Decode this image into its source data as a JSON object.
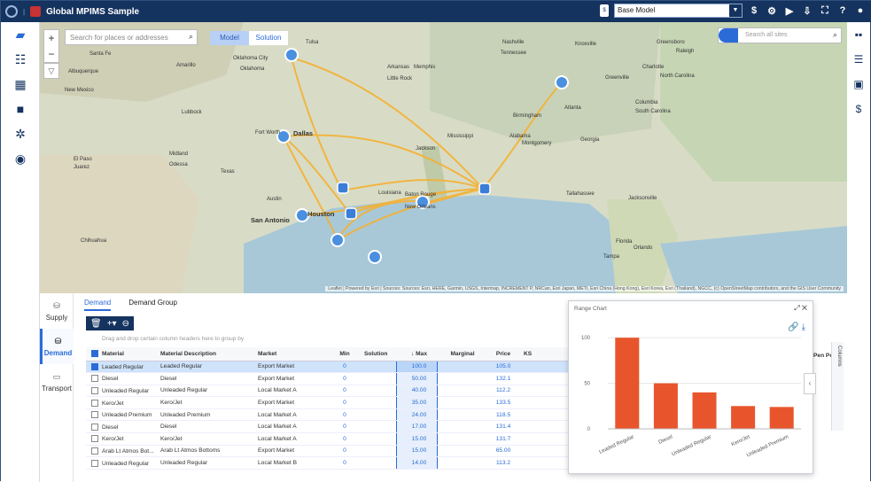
{
  "app": {
    "title": "Global MPIMS Sample",
    "scenario": "Base Model"
  },
  "map": {
    "search_placeholder": "Search for places or addresses",
    "mode_model": "Model",
    "mode_solution": "Solution",
    "site_search_placeholder": "Search all sites",
    "attribution": "Leaflet | Powered by Esri | Sources: Sources: Esri, HERE, Garmin, USGS, Intermap, INCREMENT P, NRCan, Esri Japan, METI, Esri China (Hong Kong), Esri Korea, Esri (Thailand), NGCC, (c) OpenStreetMap contributors, and the GIS User Community",
    "places": [
      "Santa Fe",
      "Albuquerque",
      "Amarillo",
      "Oklahoma City",
      "Oklahoma",
      "Tulsa",
      "New Mexico",
      "Lubbock",
      "Fort Worth",
      "Dallas",
      "Midland",
      "Odessa",
      "El Paso",
      "Juarez",
      "Texas",
      "Austin",
      "San Antonio",
      "Houston",
      "Chihuahua",
      "Arkansas",
      "Memphis",
      "Little Rock",
      "Nashville",
      "Tennessee",
      "Knoxville",
      "Greensboro",
      "Raleigh",
      "Charlotte",
      "North Carolina",
      "Greenville",
      "Columbia",
      "South Carolina",
      "Atlanta",
      "Birmingham",
      "Montgomery",
      "Georgia",
      "Jackson",
      "Mississippi",
      "Alabama",
      "Louisiana",
      "Baton Rouge",
      "New Orleans",
      "Tallahassee",
      "Jacksonville",
      "Florida",
      "Orlando",
      "Tampa"
    ]
  },
  "sidetabs": {
    "supply": "Supply",
    "demand": "Demand",
    "transport": "Transport"
  },
  "tabs": {
    "demand": "Demand",
    "demand_group": "Demand Group"
  },
  "grid": {
    "group_hint": "Drag and drop certain column headers here to group by",
    "columns": [
      "Material",
      "Material Description",
      "Market",
      "Min",
      "Solution",
      "Max",
      "Marginal",
      "Price",
      "KS"
    ],
    "extra_col": "Pen Pen...",
    "columns_tab": "Columns",
    "rows": [
      [
        "Leaded Regular",
        "Leaded Regular",
        "Export Market",
        "0",
        "",
        "100.0",
        "",
        "105.0"
      ],
      [
        "Diesel",
        "Diesel",
        "Export Market",
        "0",
        "",
        "50.00",
        "",
        "132.1"
      ],
      [
        "Unleaded Regular",
        "Unleaded Regular",
        "Local Market A",
        "0",
        "",
        "40.00",
        "",
        "112.2"
      ],
      [
        "Kero/Jet",
        "Kero/Jet",
        "Export Market",
        "0",
        "",
        "35.00",
        "",
        "133.5"
      ],
      [
        "Unleaded Premium",
        "Unleaded Premium",
        "Local Market A",
        "0",
        "",
        "24.00",
        "",
        "118.5"
      ],
      [
        "Diesel",
        "Diesel",
        "Local Market A",
        "0",
        "",
        "17.00",
        "",
        "131.4"
      ],
      [
        "Kero/Jet",
        "Kero/Jet",
        "Local Market A",
        "0",
        "",
        "15.00",
        "",
        "131.7"
      ],
      [
        "Arab Lt Atmos Bot...",
        "Arab Lt Atmos Bottoms",
        "Export Market",
        "0",
        "",
        "15.00",
        "",
        "65.00"
      ],
      [
        "Unleaded Regular",
        "Unleaded Regular",
        "Local Market B",
        "0",
        "",
        "14.00",
        "",
        "113.2"
      ]
    ]
  },
  "range_chart": {
    "title": "Range Chart"
  },
  "chart_data": {
    "type": "bar",
    "categories": [
      "Leaded Regular",
      "Diesel",
      "Unleaded Regular",
      "Kero/Jet",
      "Unleaded Premium"
    ],
    "values": [
      100,
      50,
      40,
      25,
      24
    ],
    "yticks": [
      0,
      50,
      100
    ],
    "ylim": [
      0,
      105
    ],
    "bar_color": "#e8552d"
  }
}
